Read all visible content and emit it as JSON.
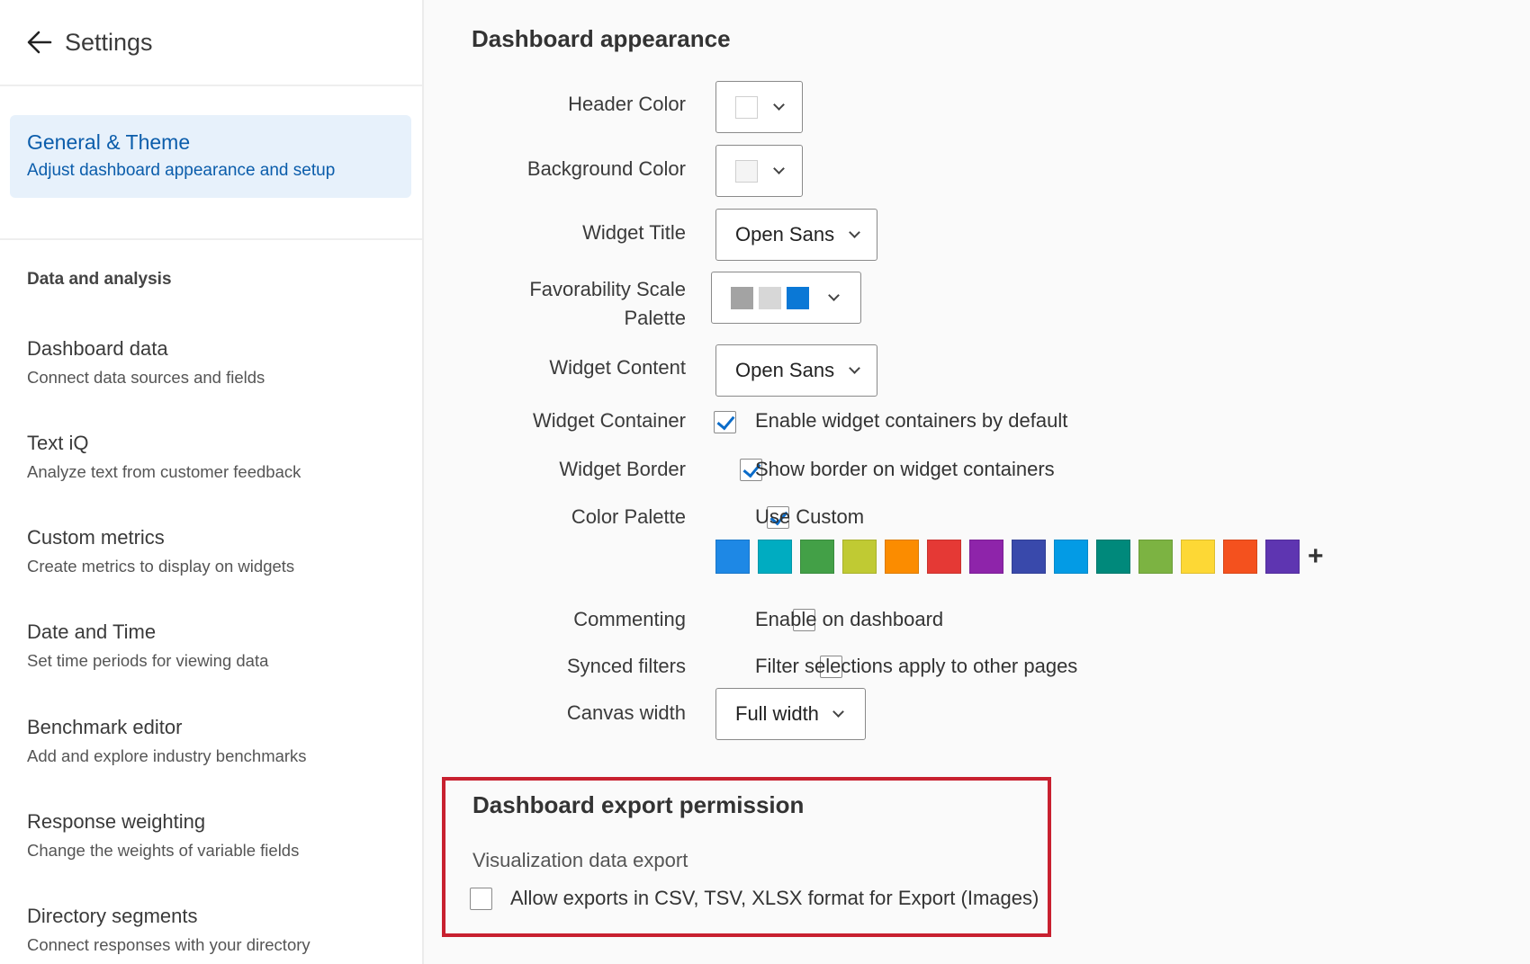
{
  "sidebar": {
    "title": "Settings",
    "active": {
      "title": "General & Theme",
      "subtitle": "Adjust dashboard appearance and setup"
    },
    "section_label": "Data and analysis",
    "items": [
      {
        "title": "Dashboard data",
        "subtitle": "Connect data sources and fields"
      },
      {
        "title": "Text iQ",
        "subtitle": "Analyze text from customer feedback"
      },
      {
        "title": "Custom metrics",
        "subtitle": "Create metrics to display on widgets"
      },
      {
        "title": "Date and Time",
        "subtitle": "Set time periods for viewing data"
      },
      {
        "title": "Benchmark editor",
        "subtitle": "Add and explore industry benchmarks"
      },
      {
        "title": "Response weighting",
        "subtitle": "Change the weights of variable fields"
      },
      {
        "title": "Directory segments",
        "subtitle": "Connect responses with your directory"
      }
    ]
  },
  "appearance": {
    "heading": "Dashboard appearance",
    "header_color": {
      "label": "Header Color",
      "color": "#ffffff"
    },
    "background_color": {
      "label": "Background Color",
      "color": "#f4f4f4"
    },
    "widget_title": {
      "label": "Widget Title",
      "value": "Open Sans"
    },
    "favorability": {
      "label_line1": "Favorability Scale",
      "label_line2": "Palette",
      "colors": [
        "#a3a3a3",
        "#d7d7d7",
        "#0a78d6"
      ]
    },
    "widget_content": {
      "label": "Widget Content",
      "value": "Open Sans"
    },
    "widget_container": {
      "label": "Widget Container",
      "text": "Enable widget containers by default",
      "checked": true
    },
    "widget_border": {
      "label": "Widget Border",
      "text": "Show border on widget containers",
      "checked": true
    },
    "color_palette": {
      "label": "Color Palette",
      "text": "Use Custom",
      "checked": true,
      "colors": [
        "#1e88e5",
        "#00acc1",
        "#43a047",
        "#c0ca33",
        "#fb8c00",
        "#e53935",
        "#8e24aa",
        "#3949ab",
        "#039be5",
        "#00897b",
        "#7cb342",
        "#fdd835",
        "#f4511e",
        "#5e35b1"
      ],
      "add_label": "+"
    },
    "commenting": {
      "label": "Commenting",
      "text": "Enable on dashboard",
      "checked": false
    },
    "synced_filters": {
      "label": "Synced filters",
      "text": "Filter selections apply to other pages",
      "checked": false
    },
    "canvas_width": {
      "label": "Canvas width",
      "value": "Full width"
    }
  },
  "export": {
    "heading": "Dashboard export permission",
    "sublabel": "Visualization data export",
    "option_text": "Allow exports in CSV, TSV, XLSX format for Export (Images)",
    "checked": false,
    "highlight_color": "#c8202f"
  }
}
